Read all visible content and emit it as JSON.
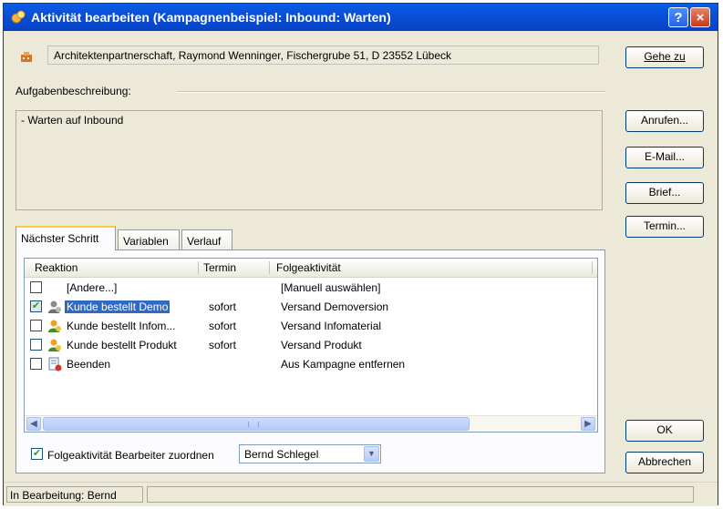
{
  "window": {
    "title": "Aktivität bearbeiten (Kampagnenbeispiel: Inbound: Warten)",
    "help_label": "?",
    "close_label": "×"
  },
  "address": {
    "text": "Architektenpartnerschaft, Raymond Wenninger, Fischergrube 51, D 23552 Lübeck",
    "goto_label": "Gehe zu"
  },
  "description": {
    "label": "Aufgabenbeschreibung:",
    "text": "- Warten auf Inbound"
  },
  "actions": {
    "call_label": "Anrufen...",
    "email_label": "E-Mail...",
    "letter_label": "Brief...",
    "appointment_label": "Termin..."
  },
  "tabs": [
    {
      "label": "Nächster Schritt",
      "active": true
    },
    {
      "label": "Variablen",
      "active": false
    },
    {
      "label": "Verlauf",
      "active": false
    }
  ],
  "list": {
    "columns": [
      "Reaktion",
      "Termin",
      "Folgeaktivität"
    ],
    "rows": [
      {
        "checked": false,
        "icon": "none",
        "reaction": "[Andere...]",
        "termin": "",
        "follow": "[Manuell auswählen]",
        "selected": false
      },
      {
        "checked": true,
        "icon": "person-gray-icon",
        "reaction": "Kunde bestellt Demo",
        "termin": "sofort",
        "follow": "Versand Demoversion",
        "selected": true
      },
      {
        "checked": false,
        "icon": "person-orange-icon",
        "reaction": "Kunde bestellt Infom...",
        "termin": "sofort",
        "follow": "Versand Infomaterial",
        "selected": false
      },
      {
        "checked": false,
        "icon": "person-orange-icon",
        "reaction": "Kunde bestellt Produkt",
        "termin": "sofort",
        "follow": "Versand Produkt",
        "selected": false
      },
      {
        "checked": false,
        "icon": "document-red-icon",
        "reaction": "Beenden",
        "termin": "",
        "follow": "Aus Kampagne entfernen",
        "selected": false
      }
    ]
  },
  "assign": {
    "checked": true,
    "label": "Folgeaktivität Bearbeiter zuordnen",
    "selected_user": "Bernd Schlegel"
  },
  "buttons": {
    "ok_label": "OK",
    "cancel_label": "Abbrechen"
  },
  "status": {
    "text": "In Bearbeitung: Bernd"
  },
  "colors": {
    "titlebar": "#0a4fd8",
    "selection": "#316ac5",
    "dialog_bg": "#ece9d8"
  }
}
